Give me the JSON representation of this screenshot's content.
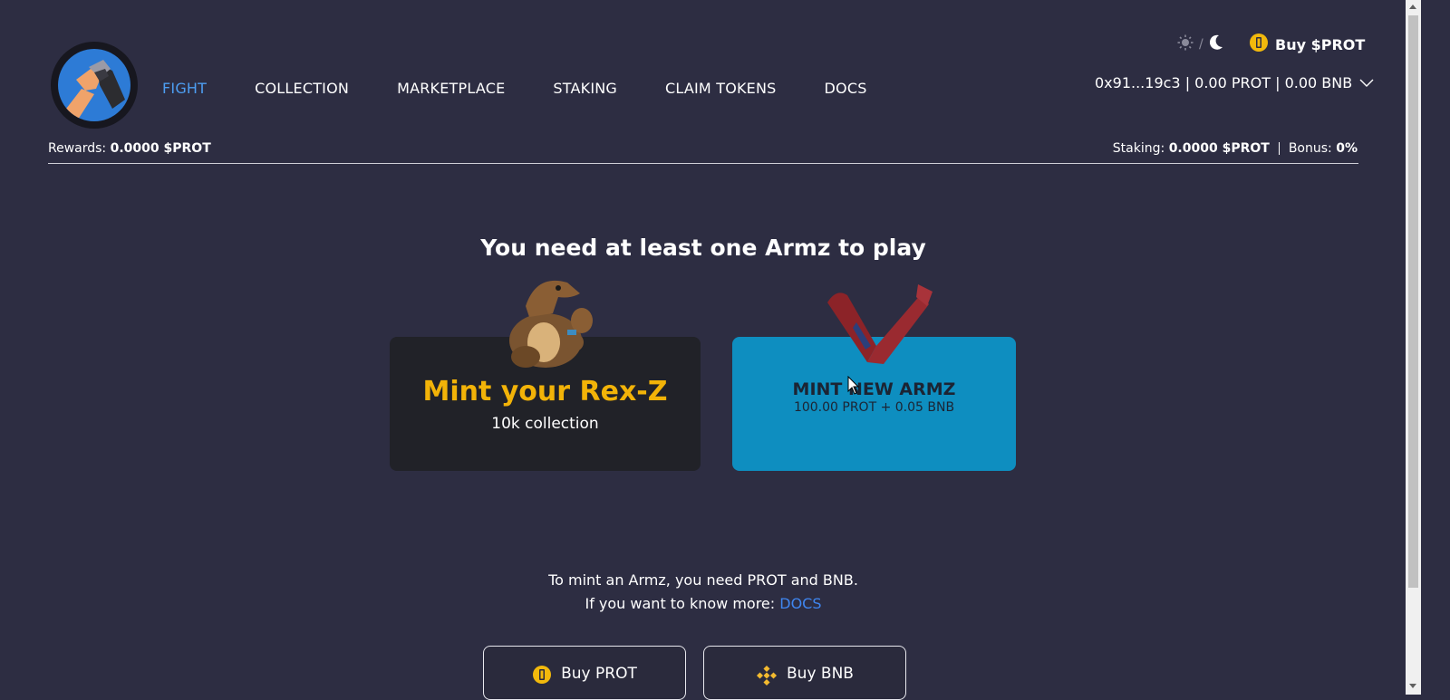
{
  "nav": {
    "items": [
      {
        "label": "FIGHT",
        "active": true
      },
      {
        "label": "COLLECTION"
      },
      {
        "label": "MARKETPLACE"
      },
      {
        "label": "STAKING"
      },
      {
        "label": "CLAIM TOKENS"
      },
      {
        "label": "DOCS"
      }
    ]
  },
  "header": {
    "theme_separator": "/",
    "buy_label": "Buy $PROT",
    "wallet": "0x91...19c3 | 0.00 PROT | 0.00 BNB"
  },
  "status": {
    "rewards_label": "Rewards:",
    "rewards_value": "0.0000 $PROT",
    "staking_label": "Staking:",
    "staking_value": "0.0000 $PROT",
    "bonus_label": "Bonus:",
    "bonus_value": "0%"
  },
  "main": {
    "heading": "You need at least one Armz to play",
    "card_rex": {
      "title": "Mint your Rex-Z",
      "subtitle": "10k collection"
    },
    "card_armz": {
      "title": "MINT NEW ARMZ",
      "price": "100.00 PROT + 0.05 BNB"
    },
    "info_line1": "To mint an Armz, you need PROT and BNB.",
    "info_line2": "If you want to know more:",
    "info_link": "DOCS",
    "buy_prot_label": "Buy PROT",
    "buy_bnb_label": "Buy BNB"
  },
  "colors": {
    "background": "#2d2d42",
    "nav_active": "#4d9ef2",
    "rex_title": "#f2b308",
    "armz_card": "#0e8ec0",
    "link": "#3f86f0"
  },
  "icons": [
    "logo-armwrestling-icon",
    "sun-icon",
    "moon-icon",
    "prot-coin-icon",
    "chevron-down-icon",
    "bnb-icon",
    "rex-dinosaur-image",
    "armz-arms-image"
  ]
}
